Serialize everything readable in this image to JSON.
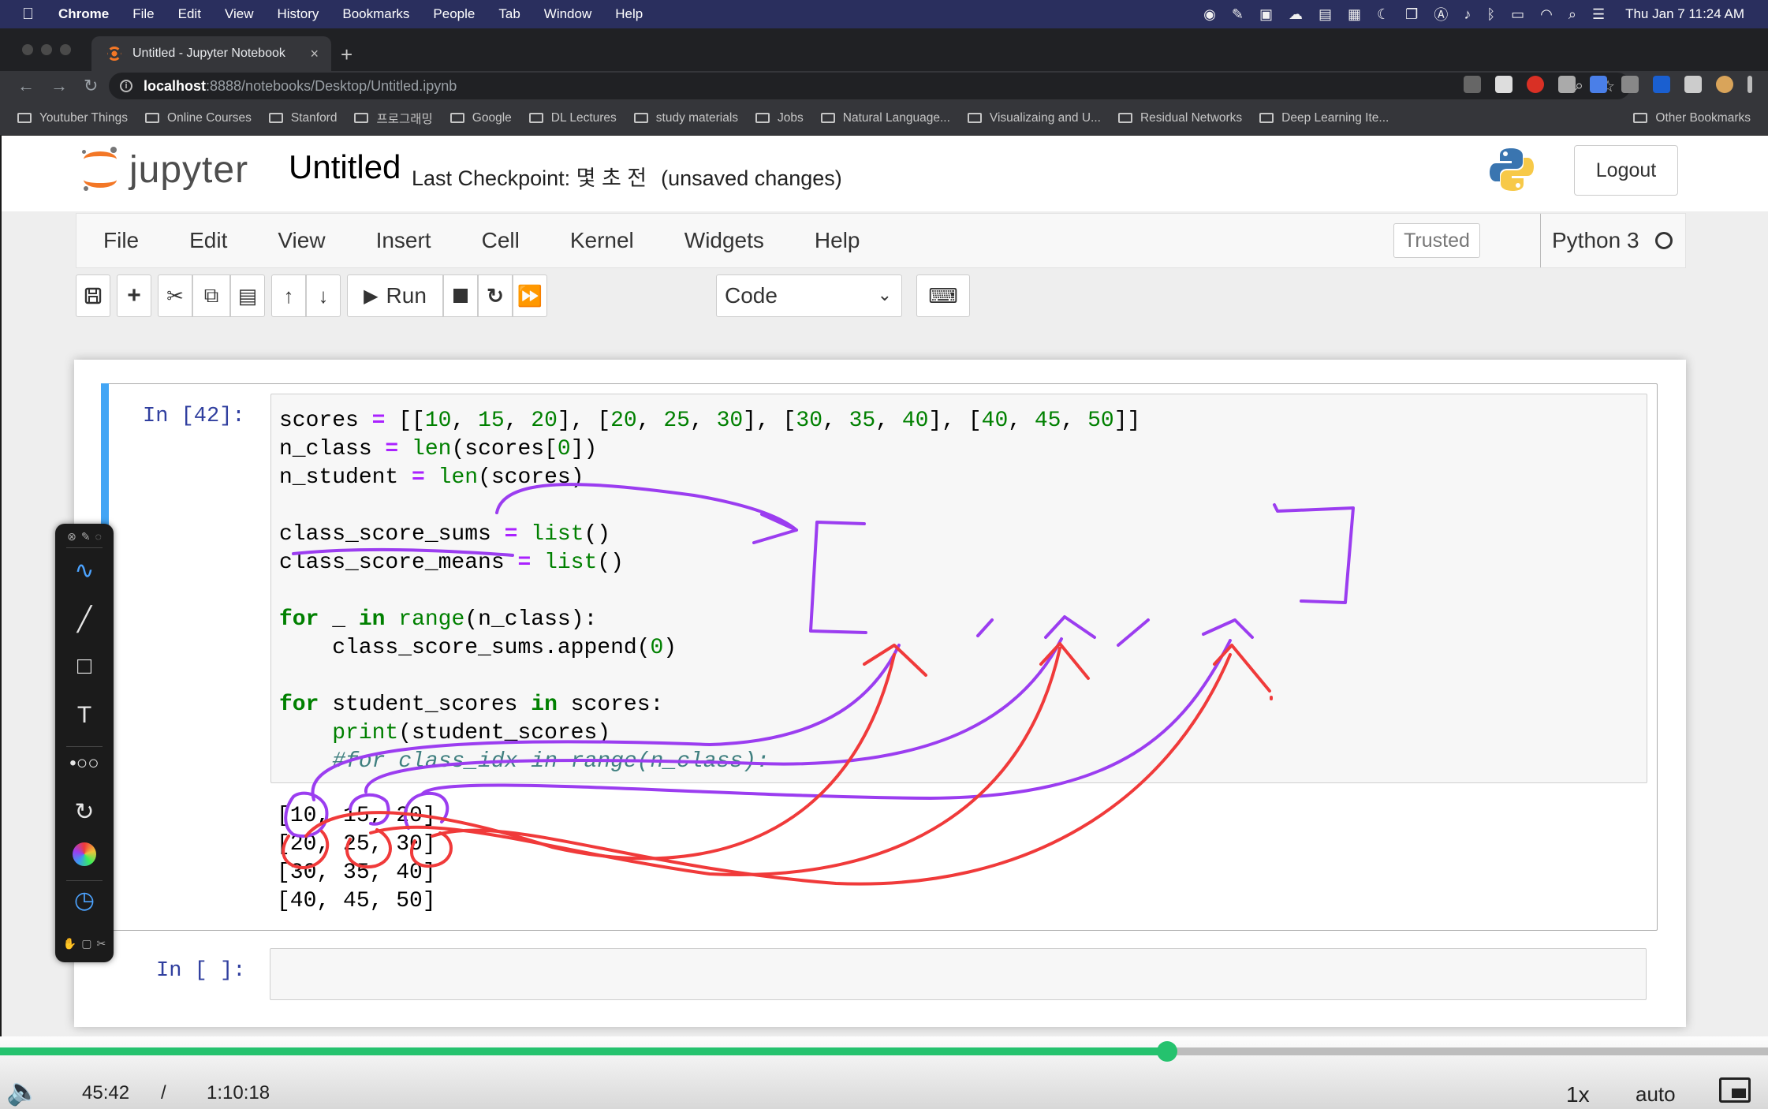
{
  "menubar": {
    "app": "Chrome",
    "items": [
      "File",
      "Edit",
      "View",
      "History",
      "Bookmarks",
      "People",
      "Tab",
      "Window",
      "Help"
    ],
    "clock": "Thu Jan 7  11:24 AM"
  },
  "tab": {
    "title": "Untitled - Jupyter Notebook",
    "close": "×",
    "new": "+"
  },
  "omnibox": {
    "host": "localhost",
    "path": ":8888/notebooks/Desktop/Untitled.ipynb"
  },
  "bookmarks": {
    "items": [
      "Youtuber Things",
      "Online Courses",
      "Stanford",
      "프로그래밍",
      "Google",
      "DL Lectures",
      "study materials",
      "Jobs",
      "Natural Language...",
      "Visualizaing and U...",
      "Residual Networks",
      "Deep Learning Ite..."
    ],
    "other": "Other Bookmarks"
  },
  "jupyter": {
    "logo_text": "jupyter",
    "notebook_name": "Untitled",
    "checkpoint": "Last Checkpoint: 몇 초 전",
    "unsaved": "(unsaved changes)",
    "logout": "Logout",
    "menu": [
      "File",
      "Edit",
      "View",
      "Insert",
      "Cell",
      "Kernel",
      "Widgets",
      "Help"
    ],
    "trusted": "Trusted",
    "kernel": "Python 3",
    "run_label": "Run",
    "cell_type": "Code"
  },
  "cells": {
    "cell1_prompt": "In [42]:",
    "cell2_prompt": "In [ ]:",
    "code_lines": [
      "scores = [[10, 15, 20], [20, 25, 30], [30, 35, 40], [40, 45, 50]]",
      "n_class = len(scores[0])",
      "n_student = len(scores)",
      "",
      "class_score_sums = list()",
      "class_score_means = list()",
      "",
      "for _ in range(n_class):",
      "    class_score_sums.append(0)",
      "",
      "for student_scores in scores:",
      "    print(student_scores)",
      "    #for class_idx in range(n_class):"
    ],
    "output_lines": [
      "[10, 15, 20]",
      "[20, 25, 30]",
      "[30, 35, 40]",
      "[40, 45, 50]"
    ]
  },
  "player": {
    "progress": 0.66,
    "current": "45:42",
    "sep": "/",
    "total": "1:10:18",
    "speed": "1x",
    "quality": "auto"
  },
  "colors": {
    "ink_purple": "#9b3df0",
    "ink_red": "#f03a3a",
    "progress": "#25c26e",
    "cell_bar": "#42a5f5"
  }
}
